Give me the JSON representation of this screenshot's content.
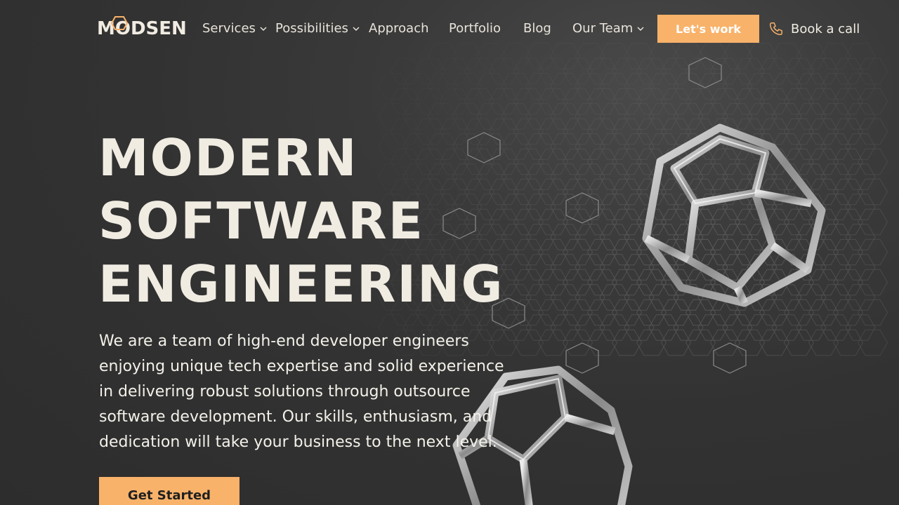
{
  "brand": {
    "name": "MODSEN",
    "accent": "#f8b26a",
    "background": "#333333"
  },
  "nav": {
    "items": [
      {
        "label": "Services",
        "has_dropdown": true
      },
      {
        "label": "Possibilities",
        "has_dropdown": true
      },
      {
        "label": "Approach",
        "has_dropdown": false
      },
      {
        "label": "Portfolio",
        "has_dropdown": false
      },
      {
        "label": "Blog",
        "has_dropdown": false
      },
      {
        "label": "Our Team",
        "has_dropdown": true
      }
    ],
    "cta_label": "Let's work",
    "book_label": "Book a call",
    "book_icon": "phone-icon"
  },
  "hero": {
    "title_lines": [
      "MODERN",
      "SOFTWARE",
      "ENGINEERING"
    ],
    "description": "We are a team of high-end developer engineers enjoying unique tech expertise and solid experience in delivering robust solutions through outsource software development. Our skills, enthusiasm, and dedication will take your business to the next level.",
    "cta_label": "Get Started"
  }
}
